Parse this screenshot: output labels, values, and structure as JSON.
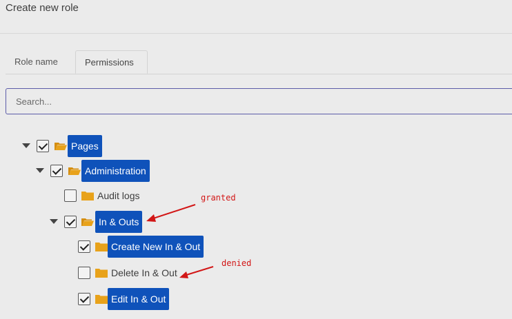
{
  "header": {
    "title": "Create new role"
  },
  "tabs": [
    {
      "label": "Role name",
      "active": false
    },
    {
      "label": "Permissions",
      "active": true
    }
  ],
  "search": {
    "placeholder": "Search...",
    "value": ""
  },
  "tree": [
    {
      "label": "Pages",
      "checked": true,
      "expanded": true,
      "selected": true,
      "level": 0
    },
    {
      "label": "Administration",
      "checked": true,
      "expanded": true,
      "selected": true,
      "level": 1
    },
    {
      "label": "Audit logs",
      "checked": false,
      "selected": false,
      "level": 2
    },
    {
      "label": "In & Outs",
      "checked": true,
      "expanded": true,
      "selected": true,
      "level": 2
    },
    {
      "label": "Create New In & Out",
      "checked": true,
      "selected": true,
      "level": 3
    },
    {
      "label": "Delete In & Out",
      "checked": false,
      "selected": false,
      "level": 3
    },
    {
      "label": "Edit In & Out",
      "checked": true,
      "selected": true,
      "level": 3
    }
  ],
  "annotations": {
    "granted": "granted",
    "denied": "denied"
  },
  "colors": {
    "selection": "#0f52ba",
    "folder": "#e8a21a",
    "annotation": "#d21616",
    "search_border": "#5b5ba8"
  }
}
